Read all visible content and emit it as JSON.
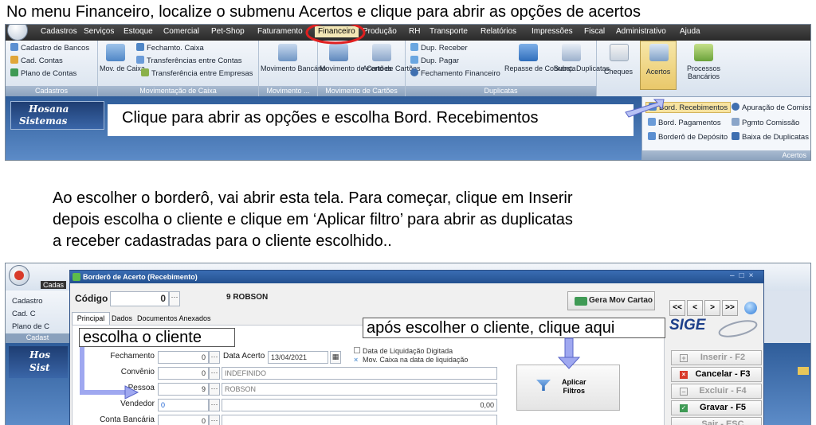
{
  "caption_top": "No menu Financeiro, localize o submenu Acertos e clique para abrir as opções de acertos",
  "panel1": {
    "menu": [
      "Cadastros",
      "Serviços",
      "Estoque",
      "Comercial",
      "Pet-Shop",
      "Faturamento",
      "Financeiro",
      "Produção",
      "RH",
      "Transporte",
      "Relatórios",
      "Impressões",
      "Fiscal",
      "Administrativo",
      "Ajuda"
    ],
    "cadastros_group": {
      "items": [
        "Cadastro de Bancos",
        "Cad. Contas",
        "Plano de Contas"
      ],
      "label": "Cadastros"
    },
    "mov_caixa_group": {
      "big": "Mov. de Caixa",
      "items": [
        "Fechamto. Caixa",
        "Transferências entre Contas",
        "Transferência entre Empresas"
      ],
      "label": "Movimentação de Caixa"
    },
    "movimento_group": {
      "big": "Movimento Bancário",
      "label": "Movimento ..."
    },
    "cartoes_group": {
      "big1": "Movimento de Cartões",
      "big2": "Acerto de Cartões",
      "label": "Movimento de Cartões"
    },
    "duplicatas_group": {
      "items": [
        "Dup. Receber",
        "Dup. Pagar",
        "Fechamento Financeiro"
      ],
      "big1": "Repasse de Cobrança",
      "big2": "Subst. Duplicatas",
      "label": "Duplicatas"
    },
    "cheques": "Cheques",
    "acertos": "Acertos",
    "processos": "Processos Bancários",
    "logo_line1": "Hosana",
    "logo_line2": "Sistemas",
    "callout": "Clique para abrir as opções e escolha Bord. Recebimentos",
    "dropdown": {
      "items": [
        "Bord. Recebimentos",
        "Apuração de Comiss",
        "Bord. Pagamentos",
        "Pgmto Comissão",
        "Borderô de Depósito",
        "Baixa de Duplicatas"
      ],
      "footer": "Acertos"
    }
  },
  "caption_mid": [
    "Ao escolher o borderô, vai abrir esta tela. Para começar, clique em Inserir",
    "depois escolha o cliente e clique em ‘Aplicar filtro’ para abrir as duplicatas",
    "a receber cadastradas para o cliente escolhido.."
  ],
  "panel2": {
    "bg_menu": [
      "Cadas",
      "Cadastro",
      "Cad. C",
      "Plano de C",
      "Cadast"
    ],
    "logo_line1": "Hos",
    "logo_line2": "Sist",
    "window_title": "Borderô de Acerto (Recebimento)",
    "codigo_label": "Código",
    "codigo_value": "0",
    "codigo_name": "9 ROBSON",
    "tabs": [
      "Principal",
      "Dados",
      "Documentos Anexados"
    ],
    "gera_mov": "Gera Mov Cartao",
    "nav": [
      "<<",
      "<",
      ">",
      ">>"
    ],
    "logo_sige": "SIGE",
    "callout_cliente": "escolha o cliente",
    "callout_aplicar": "após escolher o cliente, clique aqui",
    "fields": {
      "fechamento": {
        "label": "Fechamento",
        "value": "0"
      },
      "data_acerto": {
        "label": "Data Acerto",
        "value": "13/04/2021"
      },
      "convenio": {
        "label": "Convênio",
        "value": "0",
        "text": "INDEFINIDO"
      },
      "pessoa": {
        "label": "Pessoa",
        "value": "9",
        "text": "ROBSON"
      },
      "vendedor": {
        "label": "Vendedor",
        "value": "0",
        "amount": "0,00"
      },
      "conta_bancaria": {
        "label": "Conta Bancária",
        "value": "0"
      }
    },
    "checks": [
      "Data de Liquidação Digitada",
      "Mov. Caixa na data de liquidação"
    ],
    "aplicar": [
      "Aplicar",
      "Filtros"
    ],
    "buttons": {
      "inserir": "Inserir - F2",
      "cancelar": "Cancelar - F3",
      "excluir": "Excluir - F4",
      "gravar": "Gravar - F5",
      "sair": "Sair - ESC"
    }
  },
  "colors": {
    "highlight_ring": "#e02020",
    "ribbon_label": "#8aa1bd",
    "callout_arrow": "#9fa8f0",
    "titlebar": "#23508f"
  }
}
